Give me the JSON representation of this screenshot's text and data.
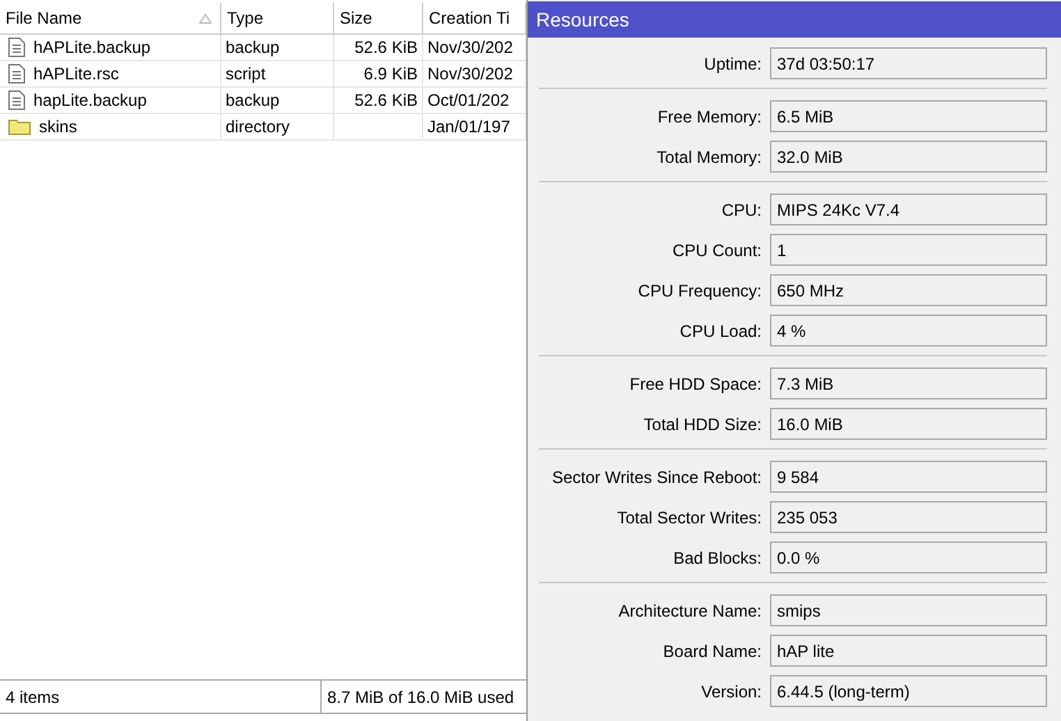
{
  "files": {
    "columns": [
      {
        "label": "File Name",
        "sorted": true
      },
      {
        "label": "Type",
        "sorted": false
      },
      {
        "label": "Size",
        "sorted": false
      },
      {
        "label": "Creation Ti",
        "sorted": false
      }
    ],
    "rows": [
      {
        "kind": "file",
        "name": "hAPLite.backup",
        "type": "backup",
        "size": "52.6 KiB",
        "created": "Nov/30/202"
      },
      {
        "kind": "file",
        "name": "hAPLite.rsc",
        "type": "script",
        "size": "6.9 KiB",
        "created": "Nov/30/202"
      },
      {
        "kind": "file",
        "name": "hapLite.backup",
        "type": "backup",
        "size": "52.6 KiB",
        "created": "Oct/01/202"
      },
      {
        "kind": "folder",
        "name": "skins",
        "type": "directory",
        "created": "Jan/01/197"
      }
    ],
    "status_bar": {
      "count": "4 items",
      "usage": "8.7 MiB of 16.0 MiB used"
    }
  },
  "resources": {
    "title": "Resources",
    "groups": [
      [
        {
          "label": "Uptime:",
          "value": "37d 03:50:17"
        }
      ],
      [
        {
          "label": "Free Memory:",
          "value": "6.5 MiB"
        },
        {
          "label": "Total Memory:",
          "value": "32.0 MiB"
        }
      ],
      [
        {
          "label": "CPU:",
          "value": "MIPS 24Kc V7.4"
        },
        {
          "label": "CPU Count:",
          "value": "1"
        },
        {
          "label": "CPU Frequency:",
          "value": "650 MHz"
        },
        {
          "label": "CPU Load:",
          "value": "4 %"
        }
      ],
      [
        {
          "label": "Free HDD Space:",
          "value": "7.3 MiB"
        },
        {
          "label": "Total HDD Size:",
          "value": "16.0 MiB"
        }
      ],
      [
        {
          "label": "Sector Writes Since Reboot:",
          "value": "9 584"
        },
        {
          "label": "Total Sector Writes:",
          "value": "235 053"
        },
        {
          "label": "Bad Blocks:",
          "value": "0.0 %"
        }
      ],
      [
        {
          "label": "Architecture Name:",
          "value": "smips"
        },
        {
          "label": "Board Name:",
          "value": "hAP lite"
        },
        {
          "label": "Version:",
          "value": "6.44.5 (long-term)"
        }
      ]
    ]
  }
}
